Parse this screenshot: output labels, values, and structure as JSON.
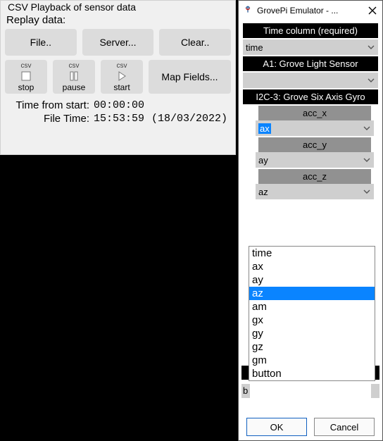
{
  "left": {
    "fieldset_title": "CSV Playback of sensor data",
    "replay_label": "Replay data:",
    "buttons": {
      "file": "File..",
      "server": "Server...",
      "clear": "Clear.."
    },
    "csv_tag": "csv",
    "csv_buttons": {
      "stop": "stop",
      "pause": "pause",
      "start": "start"
    },
    "map_fields": "Map Fields...",
    "time_from_start_label": "Time from start:",
    "time_from_start_value": "00:00:00",
    "file_time_label": "File Time:",
    "file_time_value": "15:53:59",
    "file_time_date": "(18/03/2022)"
  },
  "right": {
    "window_title": "GrovePi Emulator - ...",
    "headers": {
      "time": "Time column (required)",
      "a1": "A1: Grove Light Sensor",
      "i2c3": "I2C-3: Grove Six Axis Gyro"
    },
    "combos": {
      "time_sel": "time",
      "a1_sel": "",
      "accx_sel": "ax",
      "accy_sel": "ay",
      "accz_sel": "az"
    },
    "sublabels": {
      "accx": "acc_x",
      "accy": "acc_y",
      "accz": "acc_z"
    },
    "dropdown_options": [
      "time",
      "ax",
      "ay",
      "az",
      "am",
      "gx",
      "gy",
      "gz",
      "gm",
      "button"
    ],
    "dropdown_selected": "az",
    "stub_label": "b",
    "ok": "OK",
    "cancel": "Cancel"
  }
}
